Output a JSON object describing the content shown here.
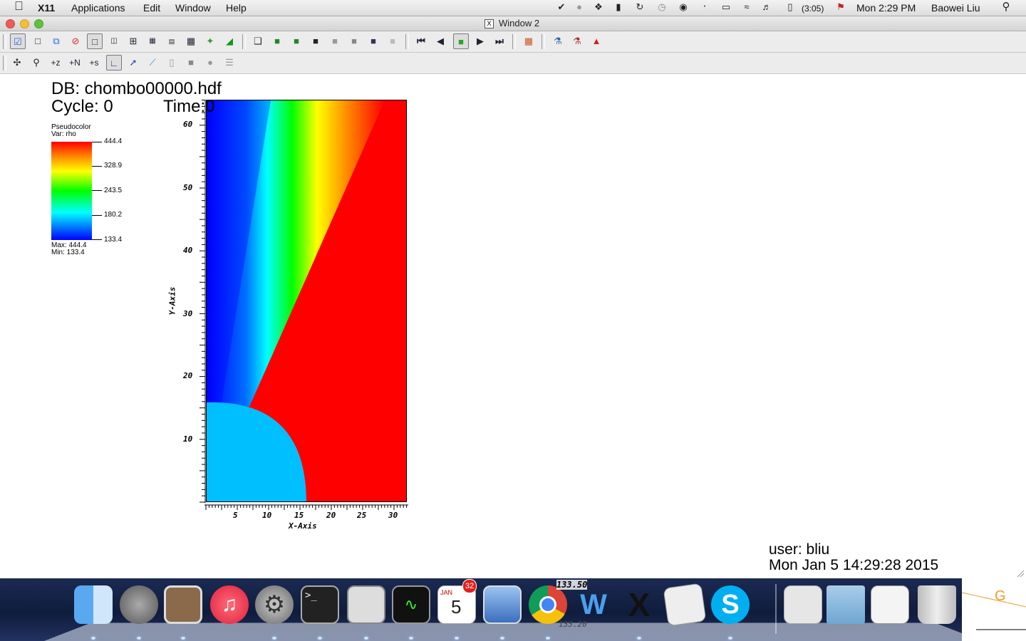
{
  "menubar": {
    "app": "X11",
    "items": [
      "Applications",
      "Edit",
      "Window",
      "Help"
    ],
    "battery": "(3:05)",
    "clock": "Mon 2:29 PM",
    "user": "Baowei Liu",
    "status_icons": [
      "task-icon",
      "notification-icon",
      "dropbox-icon",
      "battery-status-icon",
      "sync-icon",
      "time-machine-icon",
      "binoculars-icon",
      "bluetooth-icon",
      "display-icon",
      "wifi-icon",
      "volume-icon",
      "battery-icon",
      "flag-icon",
      "search-icon"
    ]
  },
  "window": {
    "title": "Window 2"
  },
  "toolbar1": {
    "icons": [
      "clear-window-icon",
      "new-window-icon",
      "copy-window-icon",
      "delete-window-icon",
      "layout-1x1-icon",
      "layout-1x2-icon",
      "layout-2x2-icon",
      "layout-2x3-icon",
      "layout-2x4-icon",
      "layout-3x3-icon",
      "lock-view-icon",
      "lock-time-icon",
      "reset-view-icon",
      "view-pick-icon",
      "camera-1-icon",
      "camera-2-icon",
      "camera-3-icon",
      "camera-4-icon",
      "camera-5-icon",
      "camera-6-icon",
      "first-frame-icon",
      "prev-frame-icon",
      "stop-icon",
      "play-icon",
      "next-frame-icon",
      "draw-plots-icon",
      "undo-icon",
      "redo-icon",
      "save-image-icon"
    ]
  },
  "toolbar2": {
    "icons": [
      "navigate-icon",
      "zoom-icon",
      "zone-pick-icon",
      "node-pick-icon",
      "spreadsheet-pick-icon",
      "lineout-icon",
      "pick-icon",
      "line-icon",
      "plane-icon",
      "box-icon",
      "sphere-icon",
      "sliders-icon"
    ]
  },
  "plot": {
    "db": "DB: chombo00000.hdf",
    "cycle": "Cycle: 0",
    "time": "Time:0",
    "legend_title": "Pseudocolor",
    "legend_var": "Var: rho",
    "legend_ticks": [
      "444.4",
      "328.9",
      "243.5",
      "180.2",
      "133.4"
    ],
    "legend_max": "Max:  444.4",
    "legend_min": "Min:  133.4",
    "x_axis_label": "X-Axis",
    "y_axis_label": "Y-Axis",
    "x_ticks": [
      "5",
      "10",
      "15",
      "20",
      "25",
      "30"
    ],
    "y_ticks": [
      "60",
      "50",
      "40",
      "30",
      "20",
      "10"
    ],
    "user": "user: bliu",
    "date": "Mon Jan  5 14:29:28 2015",
    "colors": {
      "low": "#0000ff",
      "cyan": "#00ffff",
      "green": "#00ff00",
      "yellow": "#ffff00",
      "high": "#ff0000",
      "circle": "#00bfff"
    }
  },
  "dock": {
    "items": [
      "finder-icon",
      "launchpad-icon",
      "preview-icon",
      "itunes-icon",
      "system-preferences-icon",
      "terminal-icon",
      "calculator-icon",
      "activity-monitor-icon",
      "calendar-icon",
      "mail-icon",
      "chrome-icon",
      "visit-icon",
      "x11-icon",
      "xcode-instruments-icon",
      "skype-icon",
      "document-icon",
      "folder-icon",
      "downloads-icon",
      "trash-icon"
    ],
    "calendar_badge": "32",
    "calendar_month": "JAN",
    "calendar_day": "5",
    "overlay_value_top": "133.50",
    "overlay_value_bottom": "133.20",
    "overlay_letter": "G"
  }
}
